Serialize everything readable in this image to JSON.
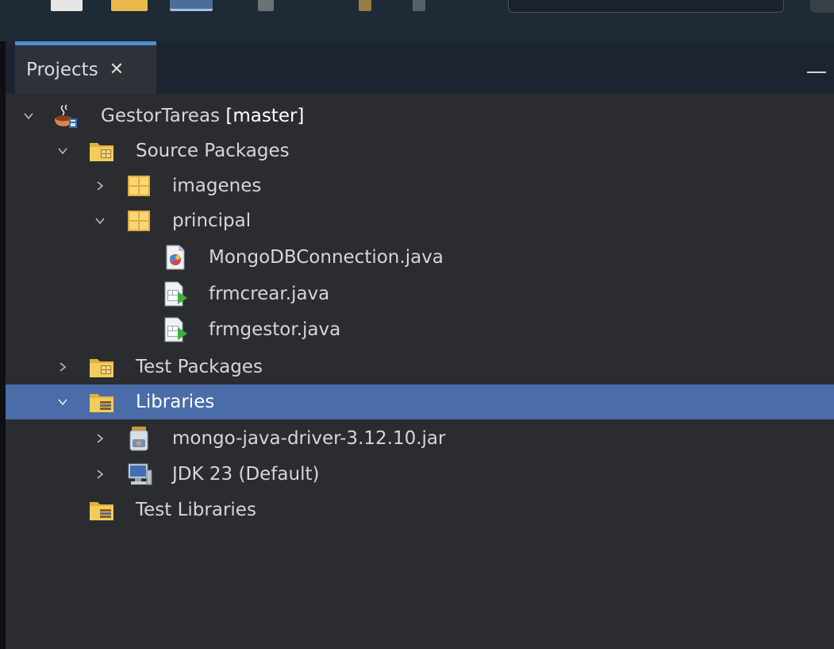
{
  "panel": {
    "tab_label": "Projects",
    "close_glyph": "✕",
    "minimize_icon": "minimize-icon"
  },
  "colors": {
    "selection": "#4a6ca8",
    "tab_accent": "#4a8fd1",
    "background": "#2a2c30",
    "text": "#d4d6da"
  },
  "tree": {
    "project": {
      "name": "GestorTareas",
      "branch": "[master]",
      "icon": "java-project-icon",
      "expanded": true
    },
    "source_packages": {
      "label": "Source Packages",
      "icon": "source-folder-icon",
      "expanded": true
    },
    "packages": [
      {
        "label": "imagenes",
        "icon": "package-icon",
        "expanded": false
      },
      {
        "label": "principal",
        "icon": "package-icon",
        "expanded": true
      }
    ],
    "files": [
      {
        "label": "MongoDBConnection.java",
        "icon": "java-class-icon"
      },
      {
        "label": "frmcrear.java",
        "icon": "java-form-icon"
      },
      {
        "label": "frmgestor.java",
        "icon": "java-form-icon"
      }
    ],
    "test_packages": {
      "label": "Test Packages",
      "icon": "test-folder-icon",
      "expanded": false
    },
    "libraries": {
      "label": "Libraries",
      "icon": "libraries-folder-icon",
      "expanded": true,
      "selected": true
    },
    "library_items": [
      {
        "label": "mongo-java-driver-3.12.10.jar",
        "icon": "jar-icon",
        "expanded": false
      },
      {
        "label": "JDK 23 (Default)",
        "icon": "jdk-icon",
        "expanded": false
      }
    ],
    "test_libraries": {
      "label": "Test Libraries",
      "icon": "libraries-folder-icon"
    }
  }
}
